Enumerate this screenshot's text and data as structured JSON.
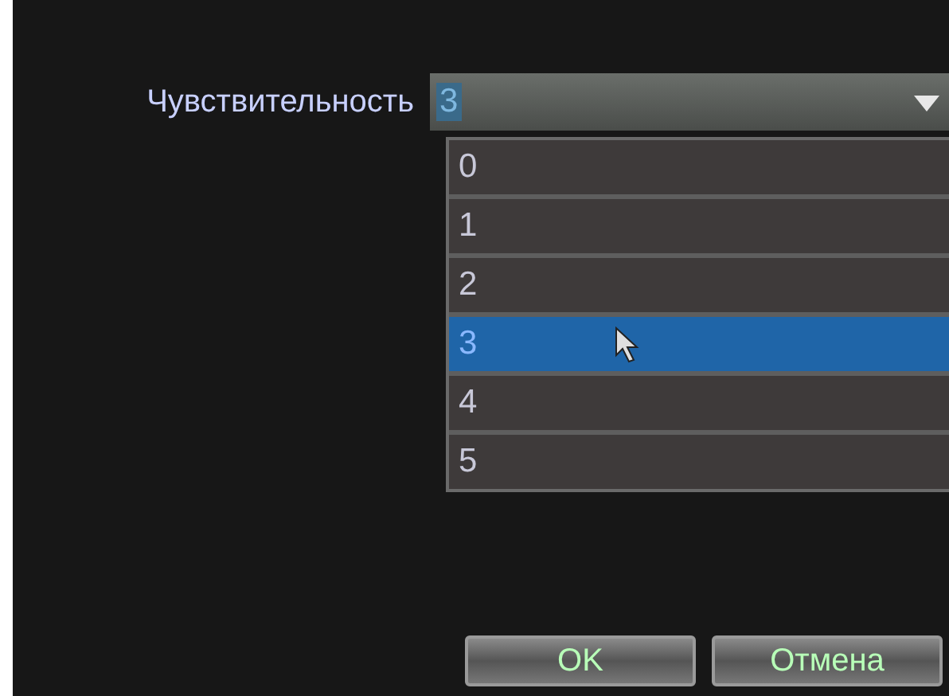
{
  "setting": {
    "label": "Чувствительность",
    "value": "3"
  },
  "options": [
    {
      "label": "0",
      "selected": false
    },
    {
      "label": "1",
      "selected": false
    },
    {
      "label": "2",
      "selected": false
    },
    {
      "label": "3",
      "selected": true
    },
    {
      "label": "4",
      "selected": false
    },
    {
      "label": "5",
      "selected": false
    }
  ],
  "buttons": [
    "OK",
    "Отмена"
  ]
}
